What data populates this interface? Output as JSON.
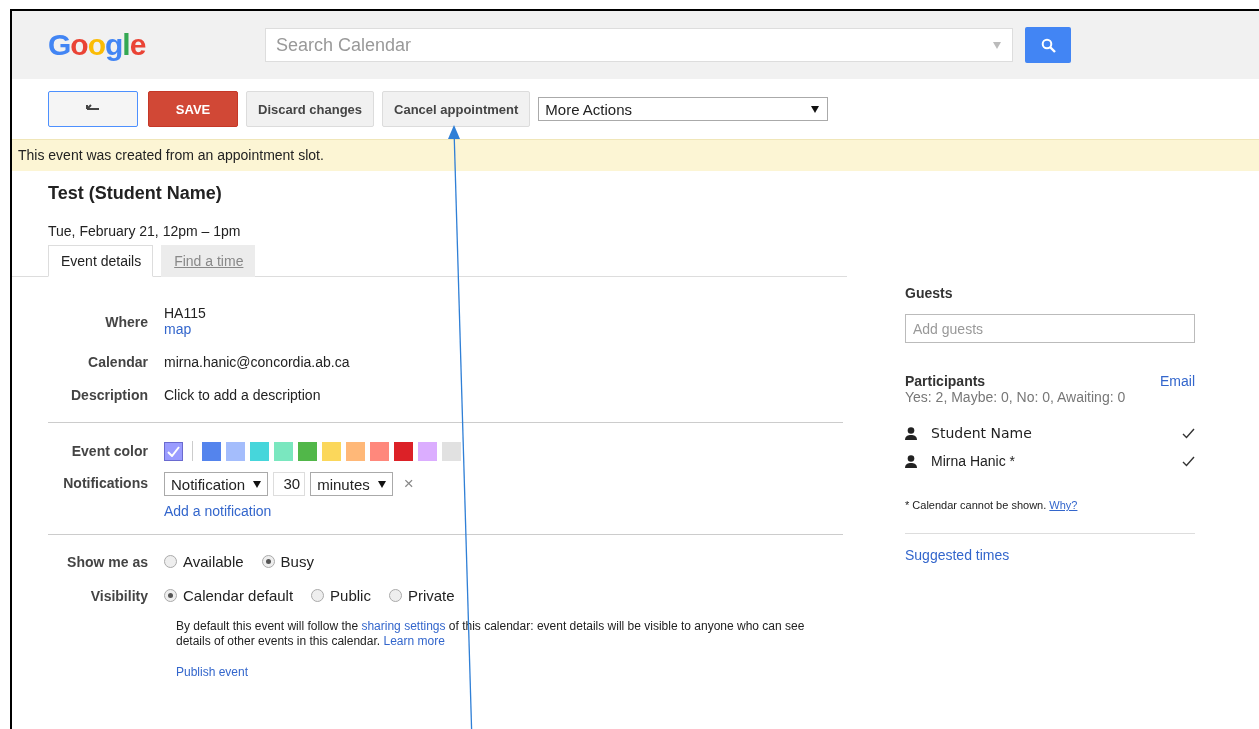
{
  "header": {
    "logo": "Google",
    "search": {
      "placeholder": "Search Calendar"
    }
  },
  "toolbar": {
    "buttons": [
      {
        "kind": "back"
      },
      {
        "kind": "primary",
        "label": "SAVE"
      },
      {
        "kind": "plain",
        "label": "Discard changes"
      },
      {
        "kind": "plain",
        "label": "Cancel appointment"
      }
    ],
    "more_actions": "More Actions"
  },
  "banner": "This event was created from an appointment slot.",
  "event": {
    "title": "Test (Student Name)",
    "when": "Tue, February 21, 12pm – 1pm"
  },
  "tabs": [
    {
      "label": "Event details",
      "selected": true
    },
    {
      "label": "Find a time",
      "selected": false
    }
  ],
  "details": {
    "where": {
      "label": "Where",
      "value": "HA115",
      "link": "map"
    },
    "calendar": {
      "label": "Calendar",
      "value": "mirna.hanic@concordia.ab.ca"
    },
    "description": {
      "label": "Description",
      "value": "Click to add a description"
    }
  },
  "event_color": {
    "label": "Event color",
    "swatches": [
      {
        "color": "#9a9cff",
        "selected": true
      },
      {
        "color": "#5484ed",
        "selected": false
      },
      {
        "color": "#a4bdfc",
        "selected": false
      },
      {
        "color": "#46d6db",
        "selected": false
      },
      {
        "color": "#7ae7bf",
        "selected": false
      },
      {
        "color": "#51b749",
        "selected": false
      },
      {
        "color": "#fbd75b",
        "selected": false
      },
      {
        "color": "#ffb878",
        "selected": false
      },
      {
        "color": "#ff887c",
        "selected": false
      },
      {
        "color": "#dc2127",
        "selected": false
      },
      {
        "color": "#dbadff",
        "selected": false
      },
      {
        "color": "#e1e1e1",
        "selected": false
      }
    ]
  },
  "notifications": {
    "label": "Notifications",
    "method": "Notification",
    "amount": "30",
    "unit": "minutes",
    "remove": "×",
    "add_link": "Add a notification"
  },
  "show_me_as": {
    "label": "Show me as",
    "options": [
      {
        "label": "Available",
        "selected": false
      },
      {
        "label": "Busy",
        "selected": true
      }
    ]
  },
  "visibility": {
    "label": "Visibility",
    "options": [
      {
        "label": "Calendar default",
        "selected": true
      },
      {
        "label": "Public",
        "selected": false
      },
      {
        "label": "Private",
        "selected": false
      }
    ],
    "note": [
      {
        "kind": "text",
        "text": "By default this event will follow the"
      },
      {
        "kind": "link",
        "text": "sharing settings"
      },
      {
        "kind": "text",
        "text": "of this calendar: event details will be visible to anyone who can see details of other events in this calendar."
      },
      {
        "kind": "link",
        "text": "Learn more"
      }
    ]
  },
  "publish_link": "Publish event",
  "guests": {
    "title": "Guests",
    "placeholder": "Add guests",
    "participants_title": "Participants",
    "email_link": "Email",
    "summary": "Yes: 2, Maybe: 0, No: 0, Awaiting: 0",
    "people": [
      {
        "name": "Student Name",
        "accepted": true
      },
      {
        "name": "Mirna Hanic *",
        "accepted": true
      }
    ],
    "footnote": {
      "text": "* Calendar cannot be shown.",
      "link": "Why?"
    },
    "suggested_link": "Suggested times"
  }
}
